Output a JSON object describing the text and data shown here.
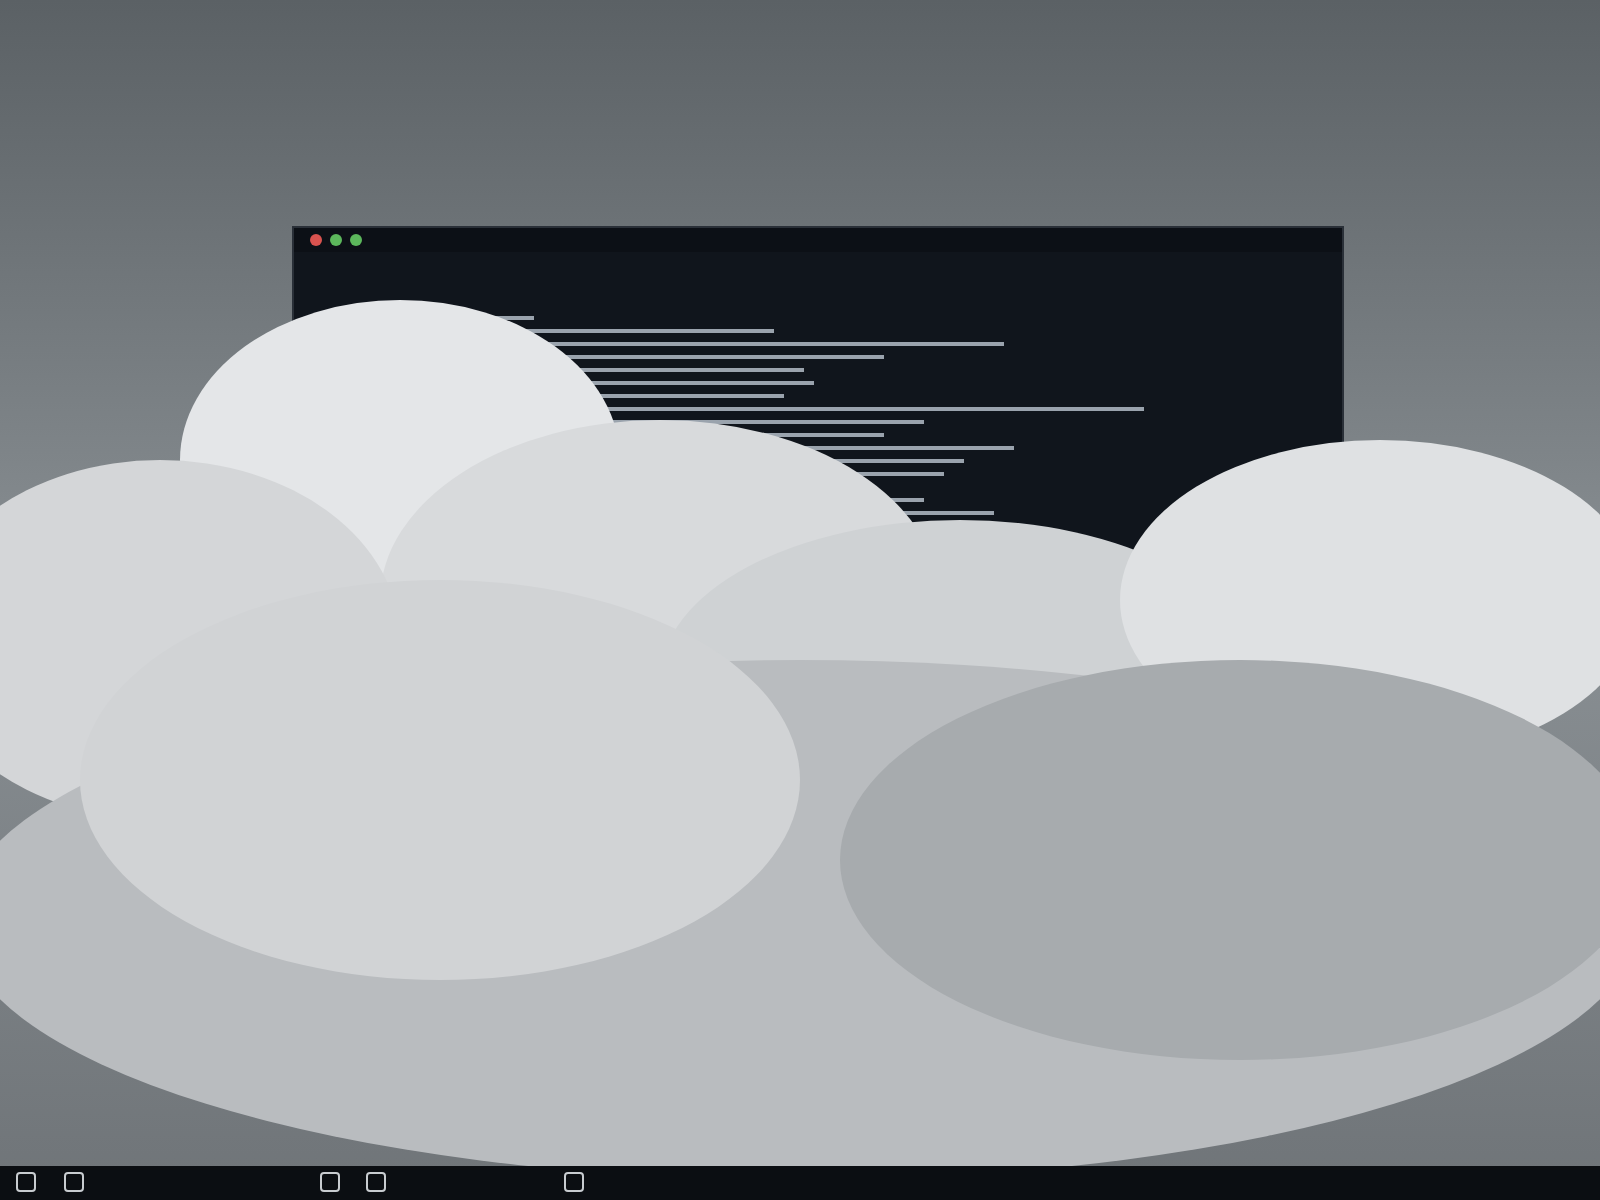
{
  "window": {
    "kind": "terminal"
  }
}
